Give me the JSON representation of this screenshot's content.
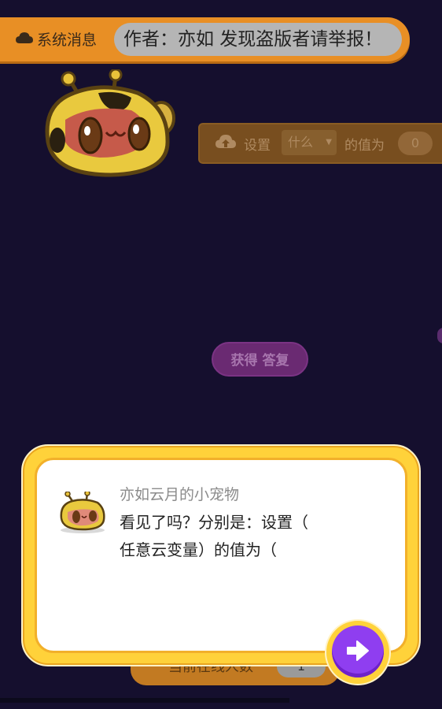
{
  "system": {
    "label": "系统消息",
    "message": "作者：亦如 发现盗版者请举报！"
  },
  "block_set": {
    "label_set": "设置",
    "dropdown_value": "什么",
    "label_value_of": "的值为",
    "value": "0"
  },
  "answer_button": {
    "label": "获得 答复"
  },
  "online": {
    "label": "当前在线人数",
    "count": "1"
  },
  "dialog": {
    "speaker": "亦如云月的小宠物",
    "line1": "看见了吗？分别是：设置（",
    "line2": "任意云变量）的值为（"
  },
  "colors": {
    "background": "#150f2e",
    "accent_orange": "#e88f25",
    "dialog_yellow": "#ffd23a",
    "next_purple": "#8f3ef0"
  }
}
